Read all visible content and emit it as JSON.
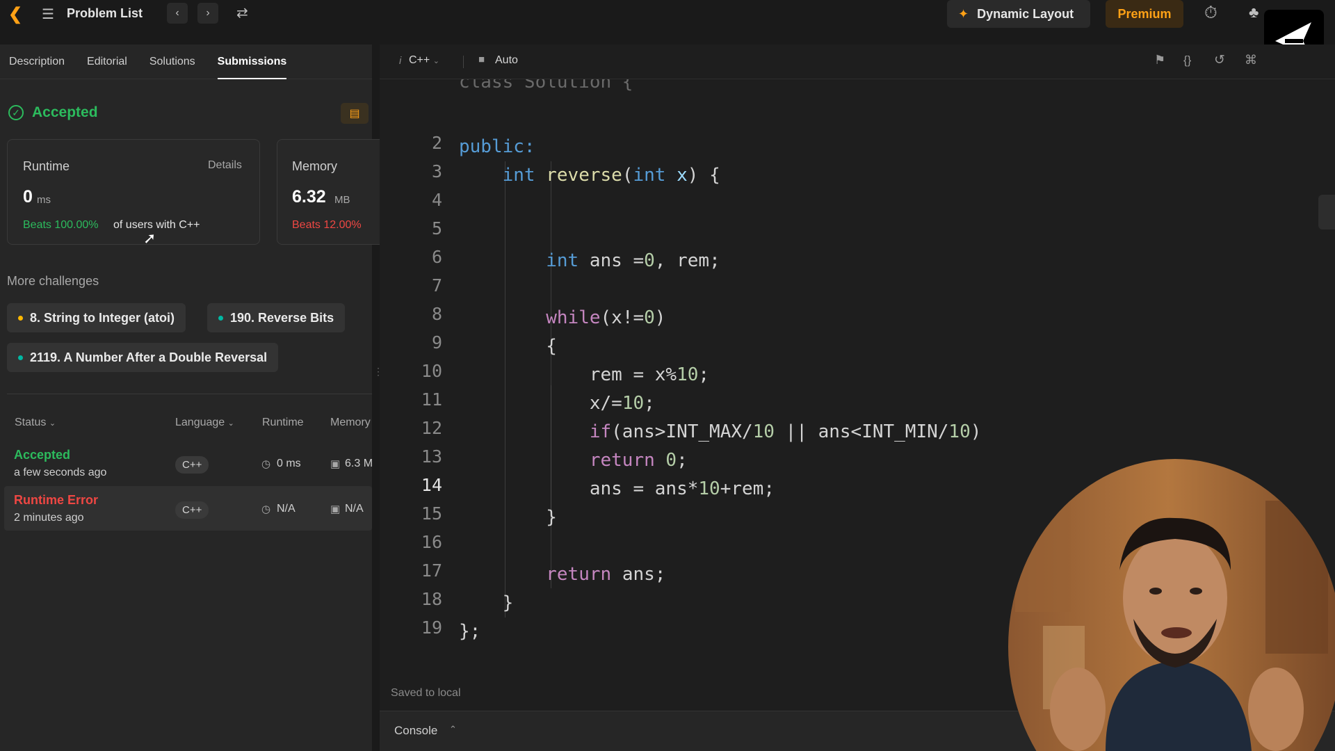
{
  "topbar": {
    "title": "Problem List",
    "dynamic_layout": "Dynamic Layout",
    "premium": "Premium"
  },
  "left": {
    "tabs": [
      "Description",
      "Editorial",
      "Solutions",
      "Submissions"
    ],
    "accepted": "Accepted",
    "runtime": {
      "label": "Runtime",
      "details": "Details",
      "value": "0",
      "unit": "ms",
      "beats": "Beats 100.00%",
      "beats_suffix": "of users with C++"
    },
    "memory": {
      "label": "Memory",
      "value": "6.32",
      "unit": "MB",
      "beats": "Beats 12.00%"
    },
    "more_challenges": "More challenges",
    "challenges": [
      {
        "label": "8. String to Integer (atoi)",
        "color": "#ffb800"
      },
      {
        "label": "190. Reverse Bits",
        "color": "#00b8a3"
      },
      {
        "label": "2119. A Number After a Double Reversal",
        "color": "#00b8a3"
      }
    ],
    "table_headers": {
      "status": "Status",
      "language": "Language",
      "runtime": "Runtime",
      "memory": "Memory"
    },
    "submissions": [
      {
        "status": "Accepted",
        "time": "a few seconds ago",
        "lang": "C++",
        "runtime": "0 ms",
        "memory": "6.3 M",
        "color": "#2cbb5d"
      },
      {
        "status": "Runtime Error",
        "time": "2 minutes ago",
        "lang": "C++",
        "runtime": "N/A",
        "memory": "N/A",
        "color": "#ef4743"
      }
    ]
  },
  "editor": {
    "language": "C++",
    "mode": "Auto",
    "saved": "Saved to local",
    "console": "Console",
    "line_numbers": [
      "2",
      "3",
      "4",
      "5",
      "6",
      "7",
      "8",
      "9",
      "10",
      "11",
      "12",
      "13",
      "14",
      "15",
      "16",
      "17",
      "18",
      "19"
    ]
  },
  "colors": {
    "accepted": "#2cbb5d",
    "error": "#ef4743",
    "premium": "#ffa116"
  }
}
